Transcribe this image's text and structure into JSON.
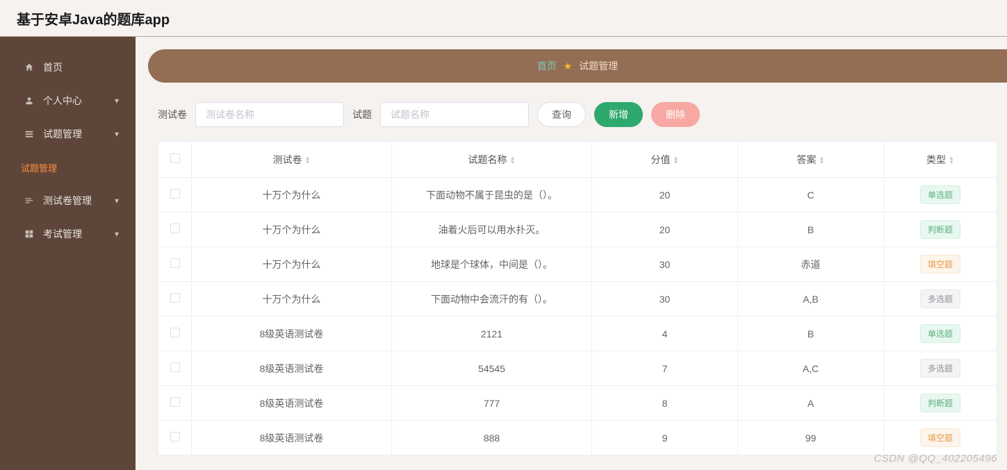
{
  "header": {
    "title": "基于安卓Java的题库app"
  },
  "sidebar": {
    "items": [
      {
        "label": "首页",
        "icon": "home",
        "expandable": false,
        "active": false
      },
      {
        "label": "个人中心",
        "icon": "user",
        "expandable": true,
        "active": false
      },
      {
        "label": "试题管理",
        "icon": "list",
        "expandable": true,
        "active": false
      },
      {
        "label": "试题管理",
        "icon": "",
        "expandable": false,
        "active": true
      },
      {
        "label": "测试卷管理",
        "icon": "lines",
        "expandable": true,
        "active": false
      },
      {
        "label": "考试管理",
        "icon": "grid",
        "expandable": true,
        "active": false
      }
    ]
  },
  "breadcrumb": {
    "home": "首页",
    "current": "试题管理"
  },
  "filters": {
    "paper_label": "测试卷",
    "paper_placeholder": "测试卷名称",
    "question_label": "试题",
    "question_placeholder": "试题名称",
    "query_label": "查询",
    "add_label": "新增",
    "delete_label": "删除"
  },
  "table": {
    "columns": [
      "测试卷",
      "试题名称",
      "分值",
      "答案",
      "类型"
    ],
    "rows": [
      {
        "paper": "十万个为什么",
        "name": "下面动物不属于昆虫的是（）。",
        "score": "20",
        "answer": "C",
        "type": "单选题",
        "type_style": "green"
      },
      {
        "paper": "十万个为什么",
        "name": "油着火后可以用水扑灭。",
        "score": "20",
        "answer": "B",
        "type": "判断题",
        "type_style": "green"
      },
      {
        "paper": "十万个为什么",
        "name": "地球是个球体，中间是（）。",
        "score": "30",
        "answer": "赤道",
        "type": "填空题",
        "type_style": "orange"
      },
      {
        "paper": "十万个为什么",
        "name": "下面动物中会流汗的有（）。",
        "score": "30",
        "answer": "A,B",
        "type": "多选题",
        "type_style": "gray"
      },
      {
        "paper": "8级英语测试卷",
        "name": "2121",
        "score": "4",
        "answer": "B",
        "type": "单选题",
        "type_style": "green"
      },
      {
        "paper": "8级英语测试卷",
        "name": "54545",
        "score": "7",
        "answer": "A,C",
        "type": "多选题",
        "type_style": "gray"
      },
      {
        "paper": "8级英语测试卷",
        "name": "777",
        "score": "8",
        "answer": "A",
        "type": "判断题",
        "type_style": "green"
      },
      {
        "paper": "8级英语测试卷",
        "name": "888",
        "score": "9",
        "answer": "99",
        "type": "填空题",
        "type_style": "orange"
      }
    ]
  },
  "watermark": "CSDN @QQ_402205496"
}
